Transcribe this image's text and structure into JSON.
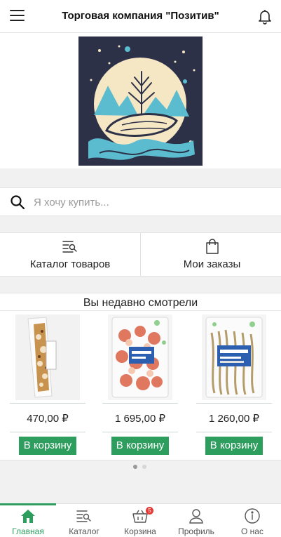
{
  "header": {
    "title": "Торговая компания \"Позитив\"",
    "menu_icon": "hamburger-menu-icon",
    "bell_icon": "bell-icon"
  },
  "search": {
    "placeholder": "Я хочу купить...",
    "value": ""
  },
  "quick_links": [
    {
      "label": "Каталог товаров",
      "icon": "catalog-search-icon"
    },
    {
      "label": "Мои заказы",
      "icon": "shopping-bag-icon"
    }
  ],
  "recent": {
    "title": "Вы недавно смотрели",
    "products": [
      {
        "price": "470,00 ₽",
        "button": "В корзину"
      },
      {
        "price": "1 695,00 ₽",
        "button": "В корзину"
      },
      {
        "price": "1 260,00 ₽",
        "button": "В корзину"
      }
    ]
  },
  "tabbar": {
    "tabs": [
      {
        "label": "Главная",
        "icon": "home-icon",
        "active": true
      },
      {
        "label": "Каталог",
        "icon": "catalog-icon"
      },
      {
        "label": "Корзина",
        "icon": "basket-icon",
        "badge": "5"
      },
      {
        "label": "Профиль",
        "icon": "user-icon"
      },
      {
        "label": "О нас",
        "icon": "info-icon"
      }
    ]
  },
  "colors": {
    "accent": "#2e9e5f",
    "badge": "#e53935",
    "logo_bg": "#2c3148",
    "logo_moon": "#f5e6c4",
    "logo_water": "#5bbcd0"
  }
}
